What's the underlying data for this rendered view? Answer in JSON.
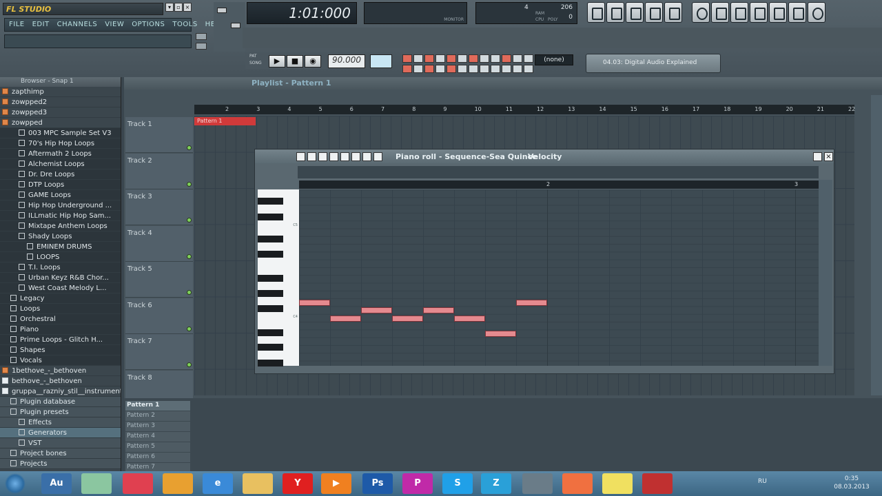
{
  "app": {
    "logo_text": "FL STUDIO",
    "menu": [
      "FILE",
      "EDIT",
      "CHANNELS",
      "VIEW",
      "OPTIONS",
      "TOOLS",
      "HELP"
    ],
    "song_position": "1:01:000",
    "monitor_label": "MONITOR",
    "ram_label": "RAM",
    "ram_value": "4",
    "ram_mb": "206",
    "cpu_label": "CPU",
    "poly_label": "POLY",
    "poly_value": "0",
    "pat_label": "PAT",
    "song_label": "SONG",
    "tempo": "90.000",
    "none_label": "(none)",
    "hint_text": "04.03: Digital Audio Explained"
  },
  "browser": {
    "title": "Browser - Snap 1",
    "items": [
      {
        "label": "zapthimp",
        "type": "folder",
        "indent": 0
      },
      {
        "label": "zowpped2",
        "type": "folder",
        "indent": 0
      },
      {
        "label": "zowpped3",
        "type": "folder",
        "indent": 0
      },
      {
        "label": "zowpped",
        "type": "folder",
        "indent": 0
      },
      {
        "label": "003 MPC Sample Set V3",
        "type": "sub",
        "indent": 2
      },
      {
        "label": "70's Hip Hop Loops",
        "type": "sub",
        "indent": 2
      },
      {
        "label": "Aftermath 2 Loops",
        "type": "sub",
        "indent": 2
      },
      {
        "label": "Alchemist Loops",
        "type": "sub",
        "indent": 2
      },
      {
        "label": "Dr. Dre Loops",
        "type": "sub",
        "indent": 2
      },
      {
        "label": "DTP Loops",
        "type": "sub",
        "indent": 2
      },
      {
        "label": "GAME Loops",
        "type": "sub",
        "indent": 2
      },
      {
        "label": "Hip Hop Underground ...",
        "type": "sub",
        "indent": 2
      },
      {
        "label": "ILLmatic Hip Hop Sam...",
        "type": "sub",
        "indent": 2
      },
      {
        "label": "Mixtape Anthem Loops",
        "type": "sub",
        "indent": 2
      },
      {
        "label": "Shady Loops",
        "type": "sub",
        "indent": 2
      },
      {
        "label": "EMINEM DRUMS",
        "type": "sub",
        "indent": 3
      },
      {
        "label": "LOOPS",
        "type": "sub",
        "indent": 3
      },
      {
        "label": "T.I. Loops",
        "type": "sub",
        "indent": 2
      },
      {
        "label": "Urban Keyz R&B Chor...",
        "type": "sub",
        "indent": 2
      },
      {
        "label": "West Coast Melody L...",
        "type": "sub",
        "indent": 2
      },
      {
        "label": "Legacy",
        "type": "sub",
        "indent": 1
      },
      {
        "label": "Loops",
        "type": "sub",
        "indent": 1
      },
      {
        "label": "Orchestral",
        "type": "sub",
        "indent": 1
      },
      {
        "label": "Piano",
        "type": "sub",
        "indent": 1
      },
      {
        "label": "Prime Loops - Glitch H...",
        "type": "sub",
        "indent": 1
      },
      {
        "label": "Shapes",
        "type": "sub",
        "indent": 1
      },
      {
        "label": "Vocals",
        "type": "sub",
        "indent": 1
      },
      {
        "label": "1bethove_-_bethoven",
        "type": "folder",
        "indent": 0
      },
      {
        "label": "bethove_-_bethoven",
        "type": "file",
        "indent": 0
      },
      {
        "label": "gruppa__razniy_stil__instrument...",
        "type": "file",
        "indent": 0
      },
      {
        "label": "Plugin database",
        "type": "sec",
        "indent": 1
      },
      {
        "label": "Plugin presets",
        "type": "sec",
        "indent": 1
      },
      {
        "label": "Effects",
        "type": "sec",
        "indent": 2
      },
      {
        "label": "Generators",
        "type": "sel",
        "indent": 2
      },
      {
        "label": "VST",
        "type": "sec",
        "indent": 2
      },
      {
        "label": "Project bones",
        "type": "sec",
        "indent": 1
      },
      {
        "label": "Projects",
        "type": "sec",
        "indent": 1
      }
    ]
  },
  "playlist": {
    "title": "Playlist - Pattern 1",
    "ruler": [
      "2",
      "3",
      "4",
      "5",
      "6",
      "7",
      "8",
      "9",
      "10",
      "11",
      "12",
      "13",
      "14",
      "15",
      "16",
      "17",
      "18",
      "19",
      "20",
      "21",
      "22"
    ],
    "tracks": [
      "Track 1",
      "Track 2",
      "Track 3",
      "Track 4",
      "Track 5",
      "Track 6",
      "Track 7",
      "Track 8"
    ],
    "clip_label": "Pattern 1",
    "patterns": [
      "Pattern 1",
      "Pattern 2",
      "Pattern 3",
      "Pattern 4",
      "Pattern 5",
      "Pattern 6",
      "Pattern 7"
    ]
  },
  "piano_roll": {
    "title": "Piano roll - Sequence-Sea Quince",
    "target": "Velocity",
    "ruler": [
      "2",
      "3"
    ],
    "key_label_c5": "C5",
    "key_label_c4": "C4",
    "notes": [
      {
        "start": 0,
        "length": 1,
        "row": 0
      },
      {
        "start": 1,
        "length": 1,
        "row": 2
      },
      {
        "start": 2,
        "length": 1,
        "row": 1
      },
      {
        "start": 3,
        "length": 1,
        "row": 2
      },
      {
        "start": 4,
        "length": 1,
        "row": 1
      },
      {
        "start": 5,
        "length": 1,
        "row": 2
      },
      {
        "start": 6,
        "length": 1,
        "row": 4
      },
      {
        "start": 7,
        "length": 1,
        "row": 0
      }
    ]
  },
  "taskbar": {
    "apps": [
      {
        "name": "audition-app",
        "label": "Au",
        "color": "#3a6fa8"
      },
      {
        "name": "shield-app",
        "label": "",
        "color": "#8bc6a0"
      },
      {
        "name": "arrow-app",
        "label": "",
        "color": "#e04050"
      },
      {
        "name": "fl-studio-app",
        "label": "",
        "color": "#e8a030"
      },
      {
        "name": "ie-app",
        "label": "e",
        "color": "#3a8ad8"
      },
      {
        "name": "explorer-app",
        "label": "",
        "color": "#e8c060"
      },
      {
        "name": "yandex-app",
        "label": "Y",
        "color": "#e02020"
      },
      {
        "name": "player-app",
        "label": "▶",
        "color": "#f08020"
      },
      {
        "name": "photoshop-app",
        "label": "Ps",
        "color": "#1e5aa8"
      },
      {
        "name": "p-app",
        "label": "P",
        "color": "#c02aa8"
      },
      {
        "name": "skype-app",
        "label": "S",
        "color": "#20a0e8"
      },
      {
        "name": "z-app",
        "label": "Z",
        "color": "#2aa0d8"
      },
      {
        "name": "controller-app",
        "label": "",
        "color": "#6a7c88"
      },
      {
        "name": "orange-app",
        "label": "",
        "color": "#f07040"
      },
      {
        "name": "notes-app",
        "label": "",
        "color": "#f0e060"
      },
      {
        "name": "tool-app",
        "label": "",
        "color": "#c03030"
      }
    ],
    "lang": "RU",
    "time": "0:35",
    "date": "08.03.2013"
  }
}
